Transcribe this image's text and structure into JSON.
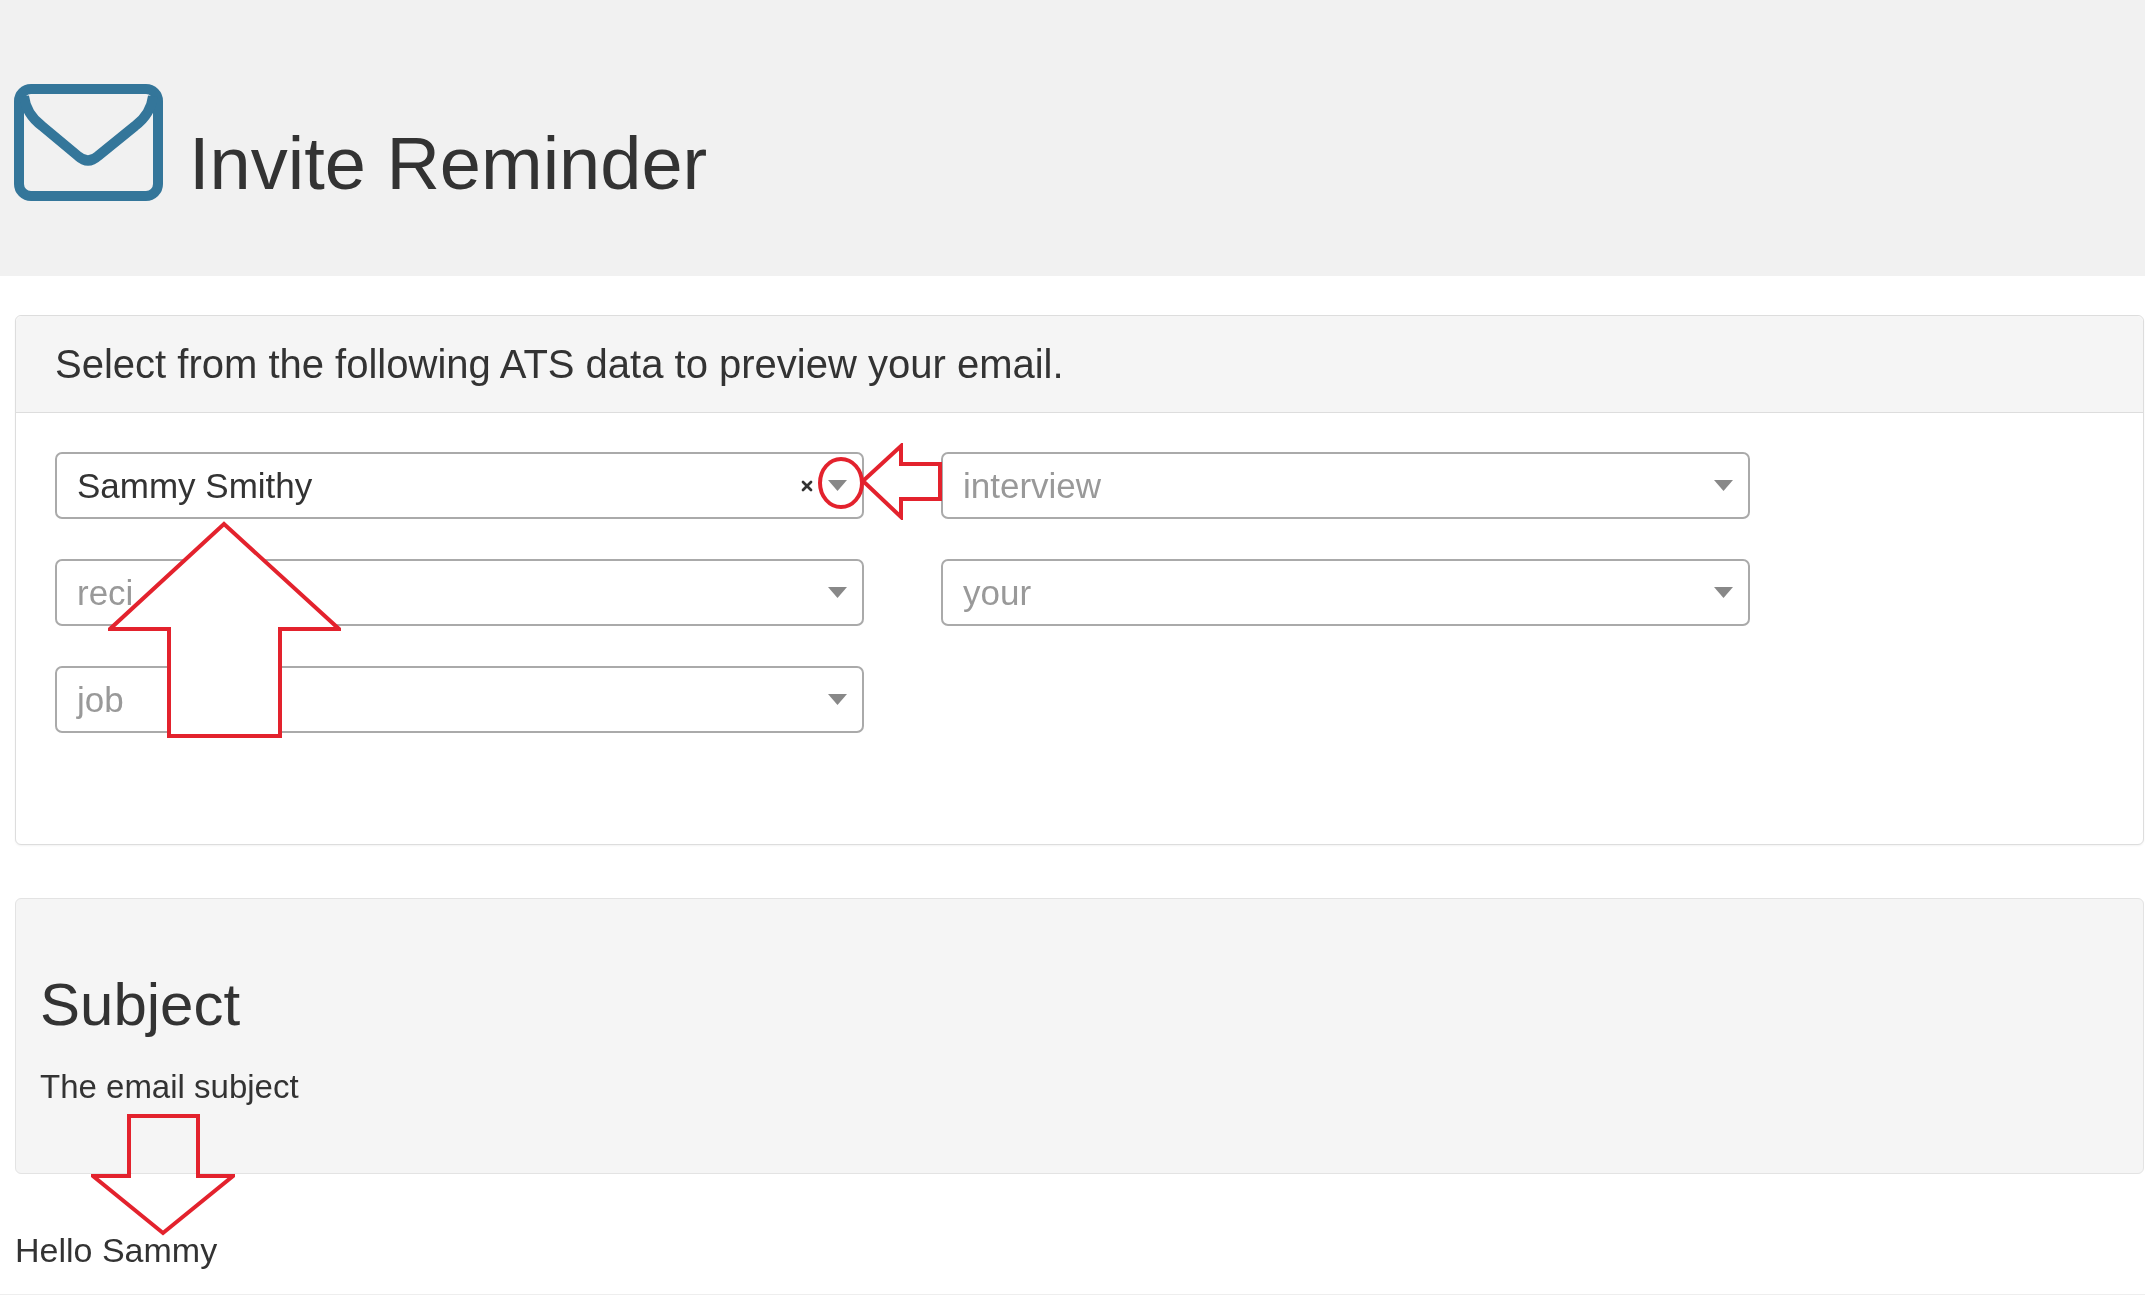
{
  "header": {
    "title": "Invite Reminder"
  },
  "ats_panel": {
    "heading": "Select from the following ATS data to preview your email.",
    "selects": [
      {
        "value": "Sammy Smithy",
        "clearable": true
      },
      {
        "placeholder": "interview",
        "clearable": false
      },
      {
        "placeholder": "reci",
        "clearable": false
      },
      {
        "placeholder": "your",
        "clearable": false
      },
      {
        "placeholder": "job",
        "clearable": false
      }
    ]
  },
  "subject_panel": {
    "heading": "Subject",
    "text": "The email subject"
  },
  "body_text": "Hello Sammy"
}
